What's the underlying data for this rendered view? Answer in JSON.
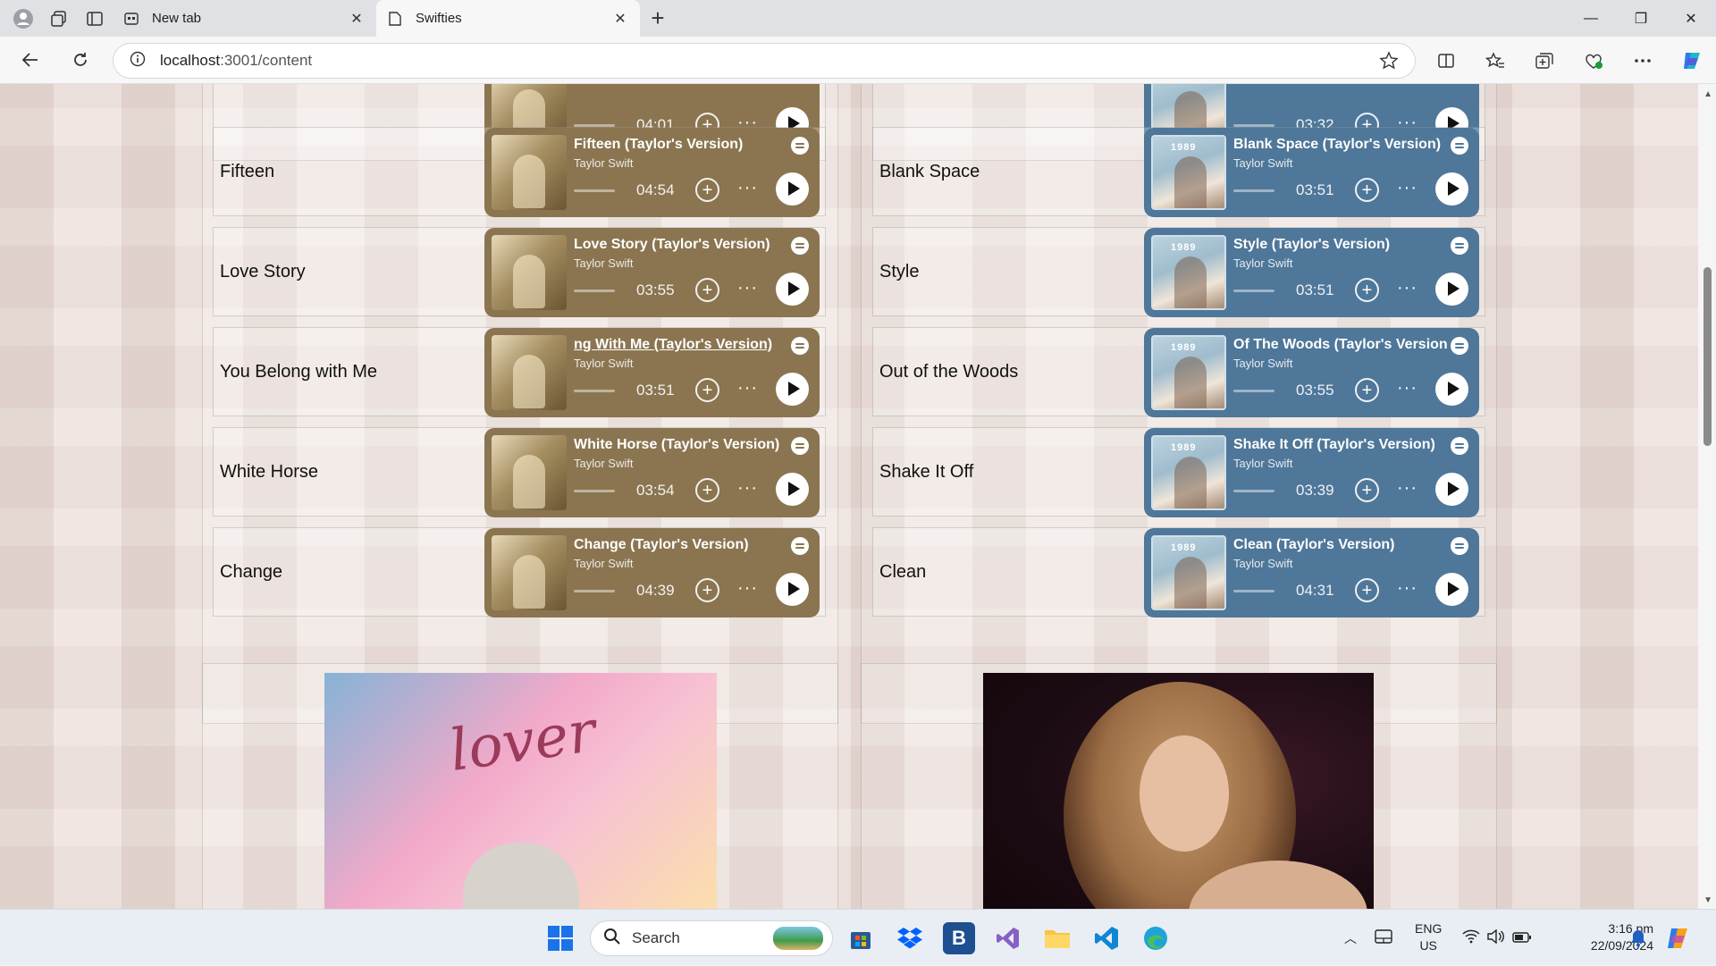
{
  "browser": {
    "tabs": [
      {
        "title": "New tab",
        "active": false
      },
      {
        "title": "Swifties",
        "active": true
      }
    ],
    "url_host": "localhost",
    "url_path": ":3001/content"
  },
  "left_column": {
    "rows": [
      {
        "label": "",
        "title": "",
        "artist": "",
        "duration": "04:01"
      },
      {
        "label": "Fifteen",
        "title": "Fifteen (Taylor's Version)",
        "artist": "Taylor Swift",
        "duration": "04:54"
      },
      {
        "label": "Love Story",
        "title": "Love Story (Taylor's Version)",
        "artist": "Taylor Swift",
        "duration": "03:55"
      },
      {
        "label": "You Belong with Me",
        "title": "ng With Me (Taylor's Version)",
        "artist": "Taylor Swift",
        "duration": "03:51"
      },
      {
        "label": "White Horse",
        "title": "White Horse (Taylor's Version)",
        "artist": "Taylor Swift",
        "duration": "03:54"
      },
      {
        "label": "Change",
        "title": "Change (Taylor's Version)",
        "artist": "Taylor Swift",
        "duration": "04:39"
      }
    ]
  },
  "right_column": {
    "rows": [
      {
        "label": "",
        "title": "",
        "artist": "",
        "duration": "03:32"
      },
      {
        "label": "Blank Space",
        "title": "Blank Space (Taylor's Version)",
        "artist": "Taylor Swift",
        "duration": "03:51"
      },
      {
        "label": "Style",
        "title": "Style (Taylor's Version)",
        "artist": "Taylor Swift",
        "duration": "03:51"
      },
      {
        "label": "Out of the Woods",
        "title": "Of The Woods (Taylor's Version)",
        "artist": "Taylor Swift",
        "duration": "03:55"
      },
      {
        "label": "Shake It Off",
        "title": "Shake It Off (Taylor's Version)",
        "artist": "Taylor Swift",
        "duration": "03:39"
      },
      {
        "label": "Clean",
        "title": "Clean (Taylor's Version)",
        "artist": "Taylor Swift",
        "duration": "04:31"
      }
    ]
  },
  "album_art_text": {
    "lover": "lover",
    "nineteen": "1989"
  },
  "colors": {
    "fearless_card": "#8a7550",
    "nineteen_card": "#4f7799"
  },
  "taskbar": {
    "search_label": "Search",
    "language_top": "ENG",
    "language_bottom": "US",
    "time": "3:16 pm",
    "date": "22/09/2024"
  }
}
